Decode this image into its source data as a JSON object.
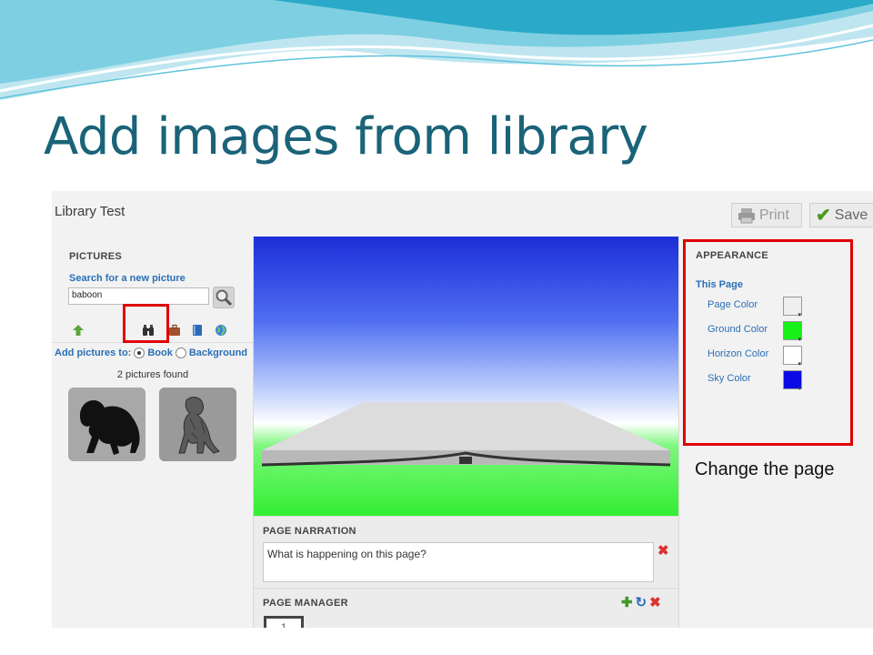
{
  "slide": {
    "title": "Add images from library",
    "callout": "Change the page"
  },
  "app": {
    "title": "Library Test",
    "print_label": "Print",
    "save_label": "Save"
  },
  "pictures_panel": {
    "heading": "PICTURES",
    "search_label": "Search for a new picture",
    "search_value": "baboon",
    "add_to_label": "Add pictures to:",
    "option_book": "Book",
    "option_background": "Background",
    "selected_option": "Book",
    "found_text": "2 pictures found"
  },
  "narration": {
    "heading": "PAGE NARRATION",
    "placeholder": "What is happening on this page?"
  },
  "page_manager": {
    "heading": "PAGE MANAGER",
    "page_number": "1"
  },
  "appearance": {
    "heading": "APPEARANCE",
    "subheading": "This Page",
    "colors": [
      {
        "label": "Page Color",
        "color": "#efefef"
      },
      {
        "label": "Ground Color",
        "color": "#19f019"
      },
      {
        "label": "Horizon Color",
        "color": "#ffffff"
      },
      {
        "label": "Sky Color",
        "color": "#0a0ae6"
      }
    ]
  },
  "accent_colors": {
    "title": "#1a6378",
    "highlight": "#e00000",
    "link": "#2a6fb5"
  }
}
